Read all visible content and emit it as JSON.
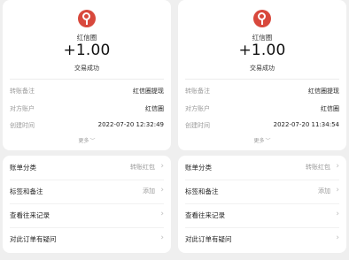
{
  "receipts": [
    {
      "merchant": "红信圈",
      "amount": "+1.00",
      "status": "交易成功",
      "details": [
        {
          "key": "转账备注",
          "value": "红信圈提现"
        },
        {
          "key": "对方账户",
          "value": "红信圈"
        },
        {
          "key": "创建时间",
          "value": "2022-07-20 12:32:49"
        }
      ],
      "more_label": "更多",
      "actions": [
        {
          "label": "账单分类",
          "value": "转账红包"
        },
        {
          "label": "标签和备注",
          "value": "添加"
        },
        {
          "label": "查看往来记录",
          "value": ""
        },
        {
          "label": "对此订单有疑问",
          "value": ""
        }
      ]
    },
    {
      "merchant": "红信圈",
      "amount": "+1.00",
      "status": "交易成功",
      "details": [
        {
          "key": "转账备注",
          "value": "红信圈提现"
        },
        {
          "key": "对方账户",
          "value": "红信圈"
        },
        {
          "key": "创建时间",
          "value": "2022-07-20 11:34:54"
        }
      ],
      "more_label": "更多",
      "actions": [
        {
          "label": "账单分类",
          "value": "转账红包"
        },
        {
          "label": "标签和备注",
          "value": "添加"
        },
        {
          "label": "查看往来记录",
          "value": ""
        },
        {
          "label": "对此订单有疑问",
          "value": ""
        }
      ]
    }
  ],
  "icons": {
    "logo": "location-pin-icon",
    "more": "chevron-down-icon",
    "row_arrow": "chevron-right-icon"
  },
  "colors": {
    "brand": "#d8483c",
    "background": "#efefef",
    "card": "#ffffff",
    "muted_text": "#9a9a9a"
  }
}
